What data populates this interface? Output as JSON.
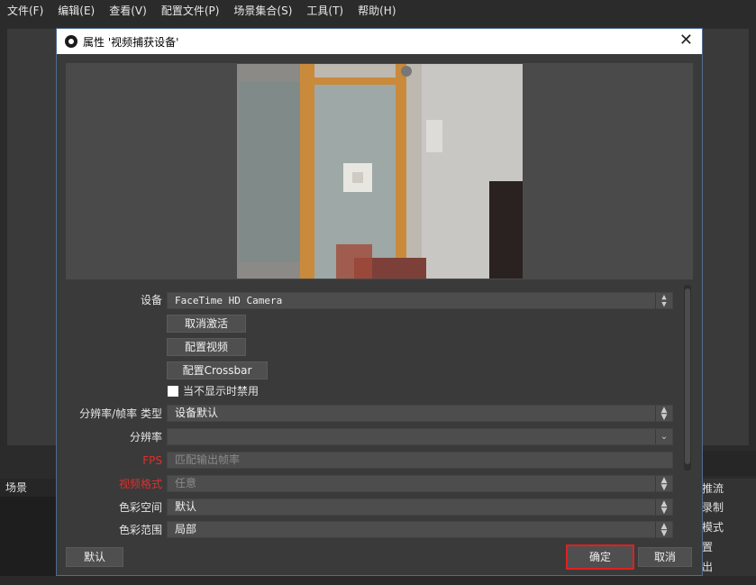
{
  "menubar": {
    "items": [
      "文件(F)",
      "编辑(E)",
      "查看(V)",
      "配置文件(P)",
      "场景集合(S)",
      "工具(T)",
      "帮助(H)"
    ]
  },
  "background": {
    "scenes_header": "场景",
    "right_buttons": [
      "推流",
      "录制",
      "模式",
      "置",
      "出"
    ]
  },
  "dialog": {
    "title": "属性 '视频捕获设备'",
    "close_glyph": "✕",
    "form": {
      "device_label": "设备",
      "device_value": "FaceTime HD Camera",
      "deactivate_button": "取消激活",
      "config_video_button": "配置视频",
      "config_crossbar_button": "配置Crossbar",
      "disable_when_hidden_label": "当不显示时禁用",
      "res_fps_type_label": "分辨率/帧率 类型",
      "res_fps_type_value": "设备默认",
      "resolution_label": "分辨率",
      "resolution_value": "",
      "fps_label": "FPS",
      "fps_value": "匹配输出帧率",
      "video_format_label": "视频格式",
      "video_format_value": "任意",
      "color_space_label": "色彩空间",
      "color_space_value": "默认",
      "color_range_label": "色彩范围",
      "color_range_value": "局部"
    },
    "footer": {
      "defaults_button": "默认",
      "ok_button": "确定",
      "cancel_button": "取消"
    }
  },
  "colors": {
    "accent_border": "#4f6c8f",
    "highlight": "#e02020",
    "label_red": "#d8322f"
  },
  "icons": {
    "spinner": "up-down-chevron-icon",
    "dropdown": "chevron-down-icon",
    "close": "close-icon",
    "app": "obs-icon"
  }
}
